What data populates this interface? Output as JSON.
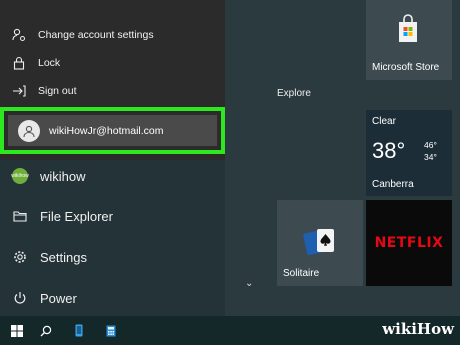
{
  "account_menu": {
    "items": [
      {
        "icon": "change-account-icon",
        "label": "Change account settings"
      },
      {
        "icon": "lock-icon",
        "label": "Lock"
      },
      {
        "icon": "sign-out-icon",
        "label": "Sign out"
      }
    ],
    "account_email": "wikiHowJr@hotmail.com",
    "highlight_color": "#2ee81f"
  },
  "left_panel": {
    "user": {
      "label": "wikihow",
      "avatar_text": "wikihow"
    },
    "items": [
      {
        "icon": "file-explorer-icon",
        "label": "File Explorer"
      },
      {
        "icon": "settings-icon",
        "label": "Settings"
      },
      {
        "icon": "power-icon",
        "label": "Power"
      }
    ]
  },
  "tiles": {
    "group_label": "Explore",
    "store": {
      "label": "Microsoft Store"
    },
    "weather": {
      "condition": "Clear",
      "temp": "38°",
      "high": "46°",
      "low": "34°",
      "city": "Canberra"
    },
    "solitaire": {
      "label": "Solitaire"
    },
    "netflix": {
      "label": "NETFLIX",
      "color": "#e50914"
    }
  },
  "taskbar": {
    "watermark": {
      "wiki": "wiki",
      "how": "How"
    }
  }
}
